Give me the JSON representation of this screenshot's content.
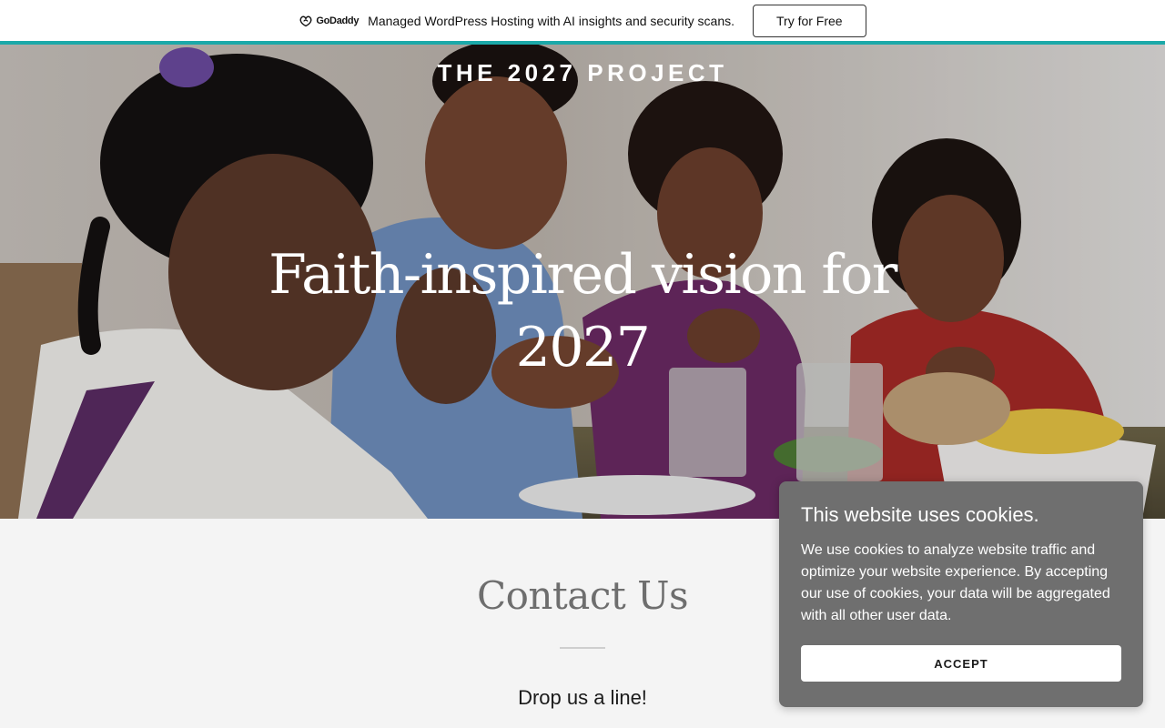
{
  "promo": {
    "brand": "GoDaddy",
    "message": "Managed WordPress Hosting with AI insights and security scans.",
    "cta_label": "Try for Free",
    "accent_color": "#1ba9a9"
  },
  "hero": {
    "site_title": "THE 2027 PROJECT",
    "heading": "Faith-inspired vision for 2027"
  },
  "contact": {
    "title": "Contact Us",
    "subtitle": "Drop us a line!"
  },
  "cookie_banner": {
    "title": "This website uses cookies.",
    "body": "We use cookies to analyze website traffic and optimize your website experience. By accepting our use of cookies, your data will be aggregated with all other user data.",
    "accept_label": "ACCEPT",
    "background_color": "#6f6f6f"
  }
}
